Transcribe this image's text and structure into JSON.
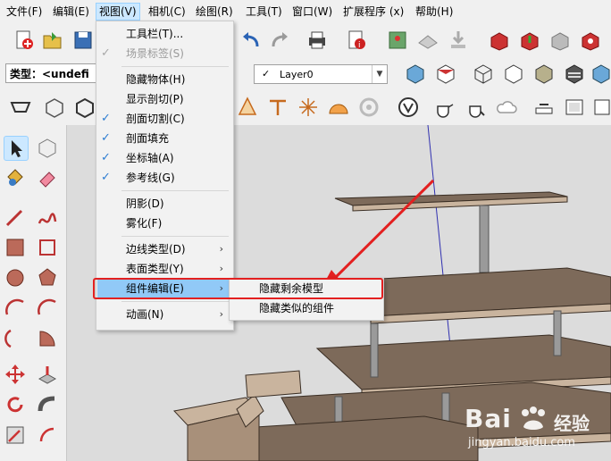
{
  "menubar": {
    "items": [
      "文件(F)",
      "编辑(E)",
      "视图(V)",
      "相机(C)",
      "绘图(R)",
      "工具(T)",
      "窗口(W)",
      "扩展程序 (x)",
      "帮助(H)"
    ],
    "active": "视图(V)"
  },
  "entity_info": {
    "type_value": "类型：<undefi"
  },
  "layer": {
    "check": "✓",
    "name": "Layer0"
  },
  "view_menu": {
    "toolbars": "工具栏(T)...",
    "scene_tabs": "场景标签(S)",
    "hidden_geometry": "隐藏物体(H)",
    "section_planes": "显示剖切(P)",
    "section_cuts": "剖面切割(C)",
    "section_fill": "剖面填充",
    "axes": "坐标轴(A)",
    "guides": "参考线(G)",
    "shadows": "阴影(D)",
    "fog": "雾化(F)",
    "edge_style": "边线类型(D)",
    "face_style": "表面类型(Y)",
    "component_edit": "组件编辑(E)",
    "animation": "动画(N)",
    "check_mark": "✓",
    "submenu_arrow": "›"
  },
  "component_submenu": {
    "hide_rest": "隐藏剩余模型",
    "hide_similar": "隐藏类似的组件"
  },
  "watermark": {
    "brand": "Bai",
    "brand_cn": "经验",
    "url": "jingyan.baidu.com"
  },
  "colors": {
    "accent_red": "#e32020",
    "highlight_blue": "#91c9f7",
    "check_blue": "#2d7dd2"
  }
}
